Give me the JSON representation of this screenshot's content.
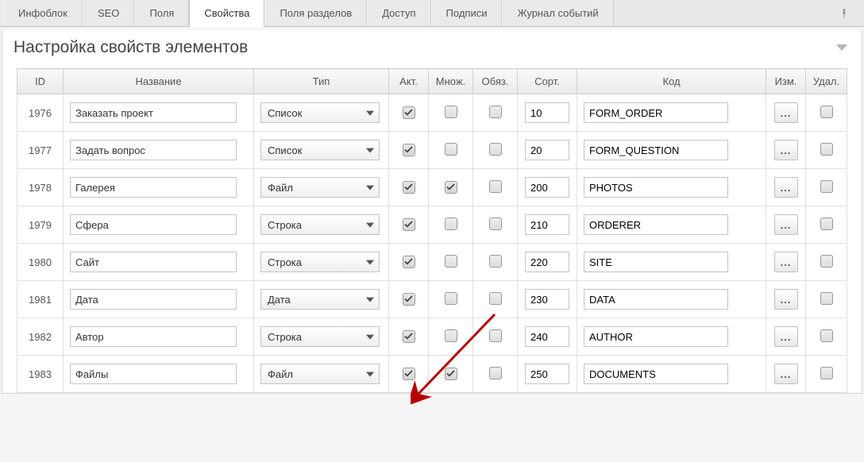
{
  "tabs": [
    {
      "label": "Инфоблок"
    },
    {
      "label": "SEO"
    },
    {
      "label": "Поля"
    },
    {
      "label": "Свойства",
      "active": true
    },
    {
      "label": "Поля разделов"
    },
    {
      "label": "Доступ"
    },
    {
      "label": "Подписи"
    },
    {
      "label": "Журнал событий"
    }
  ],
  "panel_title": "Настройка свойств элементов",
  "columns": {
    "id": "ID",
    "name": "Название",
    "type": "Тип",
    "active": "Акт.",
    "multiple": "Множ.",
    "required": "Обяз.",
    "sort": "Сорт.",
    "code": "Код",
    "edit": "Изм.",
    "delete": "Удал."
  },
  "edit_button": "...",
  "rows": [
    {
      "id": "1976",
      "name": "Заказать проект",
      "type": "Список",
      "active": true,
      "multiple": false,
      "required": false,
      "sort": "10",
      "code": "FORM_ORDER",
      "delete": false
    },
    {
      "id": "1977",
      "name": "Задать вопрос",
      "type": "Список",
      "active": true,
      "multiple": false,
      "required": false,
      "sort": "20",
      "code": "FORM_QUESTION",
      "delete": false
    },
    {
      "id": "1978",
      "name": "Галерея",
      "type": "Файл",
      "active": true,
      "multiple": true,
      "required": false,
      "sort": "200",
      "code": "PHOTOS",
      "delete": false
    },
    {
      "id": "1979",
      "name": "Сфера",
      "type": "Строка",
      "active": true,
      "multiple": false,
      "required": false,
      "sort": "210",
      "code": "ORDERER",
      "delete": false
    },
    {
      "id": "1980",
      "name": "Сайт",
      "type": "Строка",
      "active": true,
      "multiple": false,
      "required": false,
      "sort": "220",
      "code": "SITE",
      "delete": false
    },
    {
      "id": "1981",
      "name": "Дата",
      "type": "Дата",
      "active": true,
      "multiple": false,
      "required": false,
      "sort": "230",
      "code": "DATA",
      "delete": false
    },
    {
      "id": "1982",
      "name": "Автор",
      "type": "Строка",
      "active": true,
      "multiple": false,
      "required": false,
      "sort": "240",
      "code": "AUTHOR",
      "delete": false
    },
    {
      "id": "1983",
      "name": "Файлы",
      "type": "Файл",
      "active": true,
      "multiple": true,
      "required": false,
      "sort": "250",
      "code": "DOCUMENTS",
      "delete": false
    }
  ],
  "annotation": {
    "type": "arrow",
    "color": "#b80000"
  }
}
